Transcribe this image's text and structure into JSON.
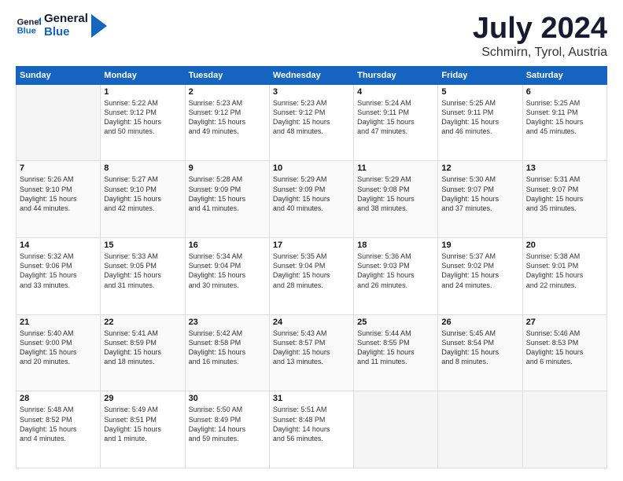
{
  "header": {
    "logo_line1": "General",
    "logo_line2": "Blue",
    "month": "July 2024",
    "location": "Schmirn, Tyrol, Austria"
  },
  "days_of_week": [
    "Sunday",
    "Monday",
    "Tuesday",
    "Wednesday",
    "Thursday",
    "Friday",
    "Saturday"
  ],
  "weeks": [
    [
      {
        "day": "",
        "info": ""
      },
      {
        "day": "1",
        "info": "Sunrise: 5:22 AM\nSunset: 9:12 PM\nDaylight: 15 hours\nand 50 minutes."
      },
      {
        "day": "2",
        "info": "Sunrise: 5:23 AM\nSunset: 9:12 PM\nDaylight: 15 hours\nand 49 minutes."
      },
      {
        "day": "3",
        "info": "Sunrise: 5:23 AM\nSunset: 9:12 PM\nDaylight: 15 hours\nand 48 minutes."
      },
      {
        "day": "4",
        "info": "Sunrise: 5:24 AM\nSunset: 9:11 PM\nDaylight: 15 hours\nand 47 minutes."
      },
      {
        "day": "5",
        "info": "Sunrise: 5:25 AM\nSunset: 9:11 PM\nDaylight: 15 hours\nand 46 minutes."
      },
      {
        "day": "6",
        "info": "Sunrise: 5:25 AM\nSunset: 9:11 PM\nDaylight: 15 hours\nand 45 minutes."
      }
    ],
    [
      {
        "day": "7",
        "info": "Sunrise: 5:26 AM\nSunset: 9:10 PM\nDaylight: 15 hours\nand 44 minutes."
      },
      {
        "day": "8",
        "info": "Sunrise: 5:27 AM\nSunset: 9:10 PM\nDaylight: 15 hours\nand 42 minutes."
      },
      {
        "day": "9",
        "info": "Sunrise: 5:28 AM\nSunset: 9:09 PM\nDaylight: 15 hours\nand 41 minutes."
      },
      {
        "day": "10",
        "info": "Sunrise: 5:29 AM\nSunset: 9:09 PM\nDaylight: 15 hours\nand 40 minutes."
      },
      {
        "day": "11",
        "info": "Sunrise: 5:29 AM\nSunset: 9:08 PM\nDaylight: 15 hours\nand 38 minutes."
      },
      {
        "day": "12",
        "info": "Sunrise: 5:30 AM\nSunset: 9:07 PM\nDaylight: 15 hours\nand 37 minutes."
      },
      {
        "day": "13",
        "info": "Sunrise: 5:31 AM\nSunset: 9:07 PM\nDaylight: 15 hours\nand 35 minutes."
      }
    ],
    [
      {
        "day": "14",
        "info": "Sunrise: 5:32 AM\nSunset: 9:06 PM\nDaylight: 15 hours\nand 33 minutes."
      },
      {
        "day": "15",
        "info": "Sunrise: 5:33 AM\nSunset: 9:05 PM\nDaylight: 15 hours\nand 31 minutes."
      },
      {
        "day": "16",
        "info": "Sunrise: 5:34 AM\nSunset: 9:04 PM\nDaylight: 15 hours\nand 30 minutes."
      },
      {
        "day": "17",
        "info": "Sunrise: 5:35 AM\nSunset: 9:04 PM\nDaylight: 15 hours\nand 28 minutes."
      },
      {
        "day": "18",
        "info": "Sunrise: 5:36 AM\nSunset: 9:03 PM\nDaylight: 15 hours\nand 26 minutes."
      },
      {
        "day": "19",
        "info": "Sunrise: 5:37 AM\nSunset: 9:02 PM\nDaylight: 15 hours\nand 24 minutes."
      },
      {
        "day": "20",
        "info": "Sunrise: 5:38 AM\nSunset: 9:01 PM\nDaylight: 15 hours\nand 22 minutes."
      }
    ],
    [
      {
        "day": "21",
        "info": "Sunrise: 5:40 AM\nSunset: 9:00 PM\nDaylight: 15 hours\nand 20 minutes."
      },
      {
        "day": "22",
        "info": "Sunrise: 5:41 AM\nSunset: 8:59 PM\nDaylight: 15 hours\nand 18 minutes."
      },
      {
        "day": "23",
        "info": "Sunrise: 5:42 AM\nSunset: 8:58 PM\nDaylight: 15 hours\nand 16 minutes."
      },
      {
        "day": "24",
        "info": "Sunrise: 5:43 AM\nSunset: 8:57 PM\nDaylight: 15 hours\nand 13 minutes."
      },
      {
        "day": "25",
        "info": "Sunrise: 5:44 AM\nSunset: 8:55 PM\nDaylight: 15 hours\nand 11 minutes."
      },
      {
        "day": "26",
        "info": "Sunrise: 5:45 AM\nSunset: 8:54 PM\nDaylight: 15 hours\nand 8 minutes."
      },
      {
        "day": "27",
        "info": "Sunrise: 5:46 AM\nSunset: 8:53 PM\nDaylight: 15 hours\nand 6 minutes."
      }
    ],
    [
      {
        "day": "28",
        "info": "Sunrise: 5:48 AM\nSunset: 8:52 PM\nDaylight: 15 hours\nand 4 minutes."
      },
      {
        "day": "29",
        "info": "Sunrise: 5:49 AM\nSunset: 8:51 PM\nDaylight: 15 hours\nand 1 minute."
      },
      {
        "day": "30",
        "info": "Sunrise: 5:50 AM\nSunset: 8:49 PM\nDaylight: 14 hours\nand 59 minutes."
      },
      {
        "day": "31",
        "info": "Sunrise: 5:51 AM\nSunset: 8:48 PM\nDaylight: 14 hours\nand 56 minutes."
      },
      {
        "day": "",
        "info": ""
      },
      {
        "day": "",
        "info": ""
      },
      {
        "day": "",
        "info": ""
      }
    ]
  ]
}
